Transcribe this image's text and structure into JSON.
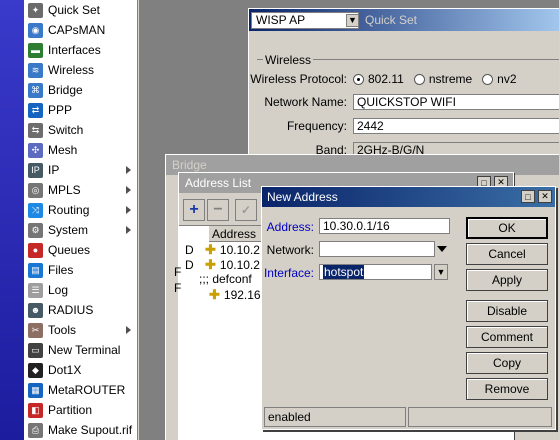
{
  "sidebar": {
    "items": [
      {
        "label": "Quick Set",
        "icon": "wand-icon",
        "color": "#6b6b6b",
        "submenu": false
      },
      {
        "label": "CAPsMAN",
        "icon": "capsman-icon",
        "color": "#3a78c8",
        "submenu": false
      },
      {
        "label": "Interfaces",
        "icon": "interfaces-icon",
        "color": "#2e7d32",
        "submenu": false
      },
      {
        "label": "Wireless",
        "icon": "wireless-icon",
        "color": "#3a78c8",
        "submenu": false
      },
      {
        "label": "Bridge",
        "icon": "bridge-icon",
        "color": "#3a78c8",
        "submenu": false
      },
      {
        "label": "PPP",
        "icon": "ppp-icon",
        "color": "#1565c0",
        "submenu": false
      },
      {
        "label": "Switch",
        "icon": "switch-icon",
        "color": "#6d6d6d",
        "submenu": false
      },
      {
        "label": "Mesh",
        "icon": "mesh-icon",
        "color": "#5c6bc0",
        "submenu": false
      },
      {
        "label": "IP",
        "icon": "ip-icon",
        "color": "#455a64",
        "submenu": true
      },
      {
        "label": "MPLS",
        "icon": "mpls-icon",
        "color": "#757575",
        "submenu": true
      },
      {
        "label": "Routing",
        "icon": "routing-icon",
        "color": "#1e88e5",
        "submenu": true
      },
      {
        "label": "System",
        "icon": "system-icon",
        "color": "#757575",
        "submenu": true
      },
      {
        "label": "Queues",
        "icon": "queues-icon",
        "color": "#c62828",
        "submenu": false
      },
      {
        "label": "Files",
        "icon": "files-icon",
        "color": "#1976d2",
        "submenu": false
      },
      {
        "label": "Log",
        "icon": "log-icon",
        "color": "#9e9e9e",
        "submenu": false
      },
      {
        "label": "RADIUS",
        "icon": "radius-icon",
        "color": "#455a64",
        "submenu": false
      },
      {
        "label": "Tools",
        "icon": "tools-icon",
        "color": "#8d6e63",
        "submenu": true
      },
      {
        "label": "New Terminal",
        "icon": "terminal-icon",
        "color": "#424242",
        "submenu": false
      },
      {
        "label": "Dot1X",
        "icon": "dot1x-icon",
        "color": "#212121",
        "submenu": false
      },
      {
        "label": "MetaROUTER",
        "icon": "metarouter-icon",
        "color": "#1565c0",
        "submenu": false
      },
      {
        "label": "Partition",
        "icon": "partition-icon",
        "color": "#c62828",
        "submenu": false
      },
      {
        "label": "Make Supout.rif",
        "icon": "supout-icon",
        "color": "#757575",
        "submenu": false
      }
    ]
  },
  "quickset": {
    "mode": "WISP AP",
    "title": "Quick Set",
    "section": "Wireless",
    "protocol_label": "Wireless Protocol:",
    "protocol_options": [
      "802.11",
      "nstreme",
      "nv2"
    ],
    "protocol_selected": "802.11",
    "network_name_label": "Network Name:",
    "network_name": "QUICKSTOP WIFI",
    "frequency_label": "Frequency:",
    "frequency": "2442",
    "band_label": "Band:",
    "band": "2GHz-B/G/N"
  },
  "bridge": {
    "title": "Bridge"
  },
  "address_list": {
    "title": "Address List",
    "column_address": "Address",
    "rows": [
      {
        "flag": "D",
        "address": "10.10.2"
      },
      {
        "flag": "D",
        "address": "10.10.2"
      },
      {
        "flag": "",
        "comment": ";;; defconf"
      },
      {
        "flag": "",
        "address": "192.16"
      }
    ],
    "row_prefix_1": "F",
    "row_prefix_2": "F"
  },
  "new_address": {
    "title": "New Address",
    "address_label": "Address:",
    "address_value": "10.30.0.1/16",
    "network_label": "Network:",
    "network_value": "",
    "interface_label": "Interface:",
    "interface_value": "hotspot",
    "buttons": {
      "ok": "OK",
      "cancel": "Cancel",
      "apply": "Apply",
      "disable": "Disable",
      "comment": "Comment",
      "copy": "Copy",
      "remove": "Remove"
    },
    "status": "enabled"
  }
}
